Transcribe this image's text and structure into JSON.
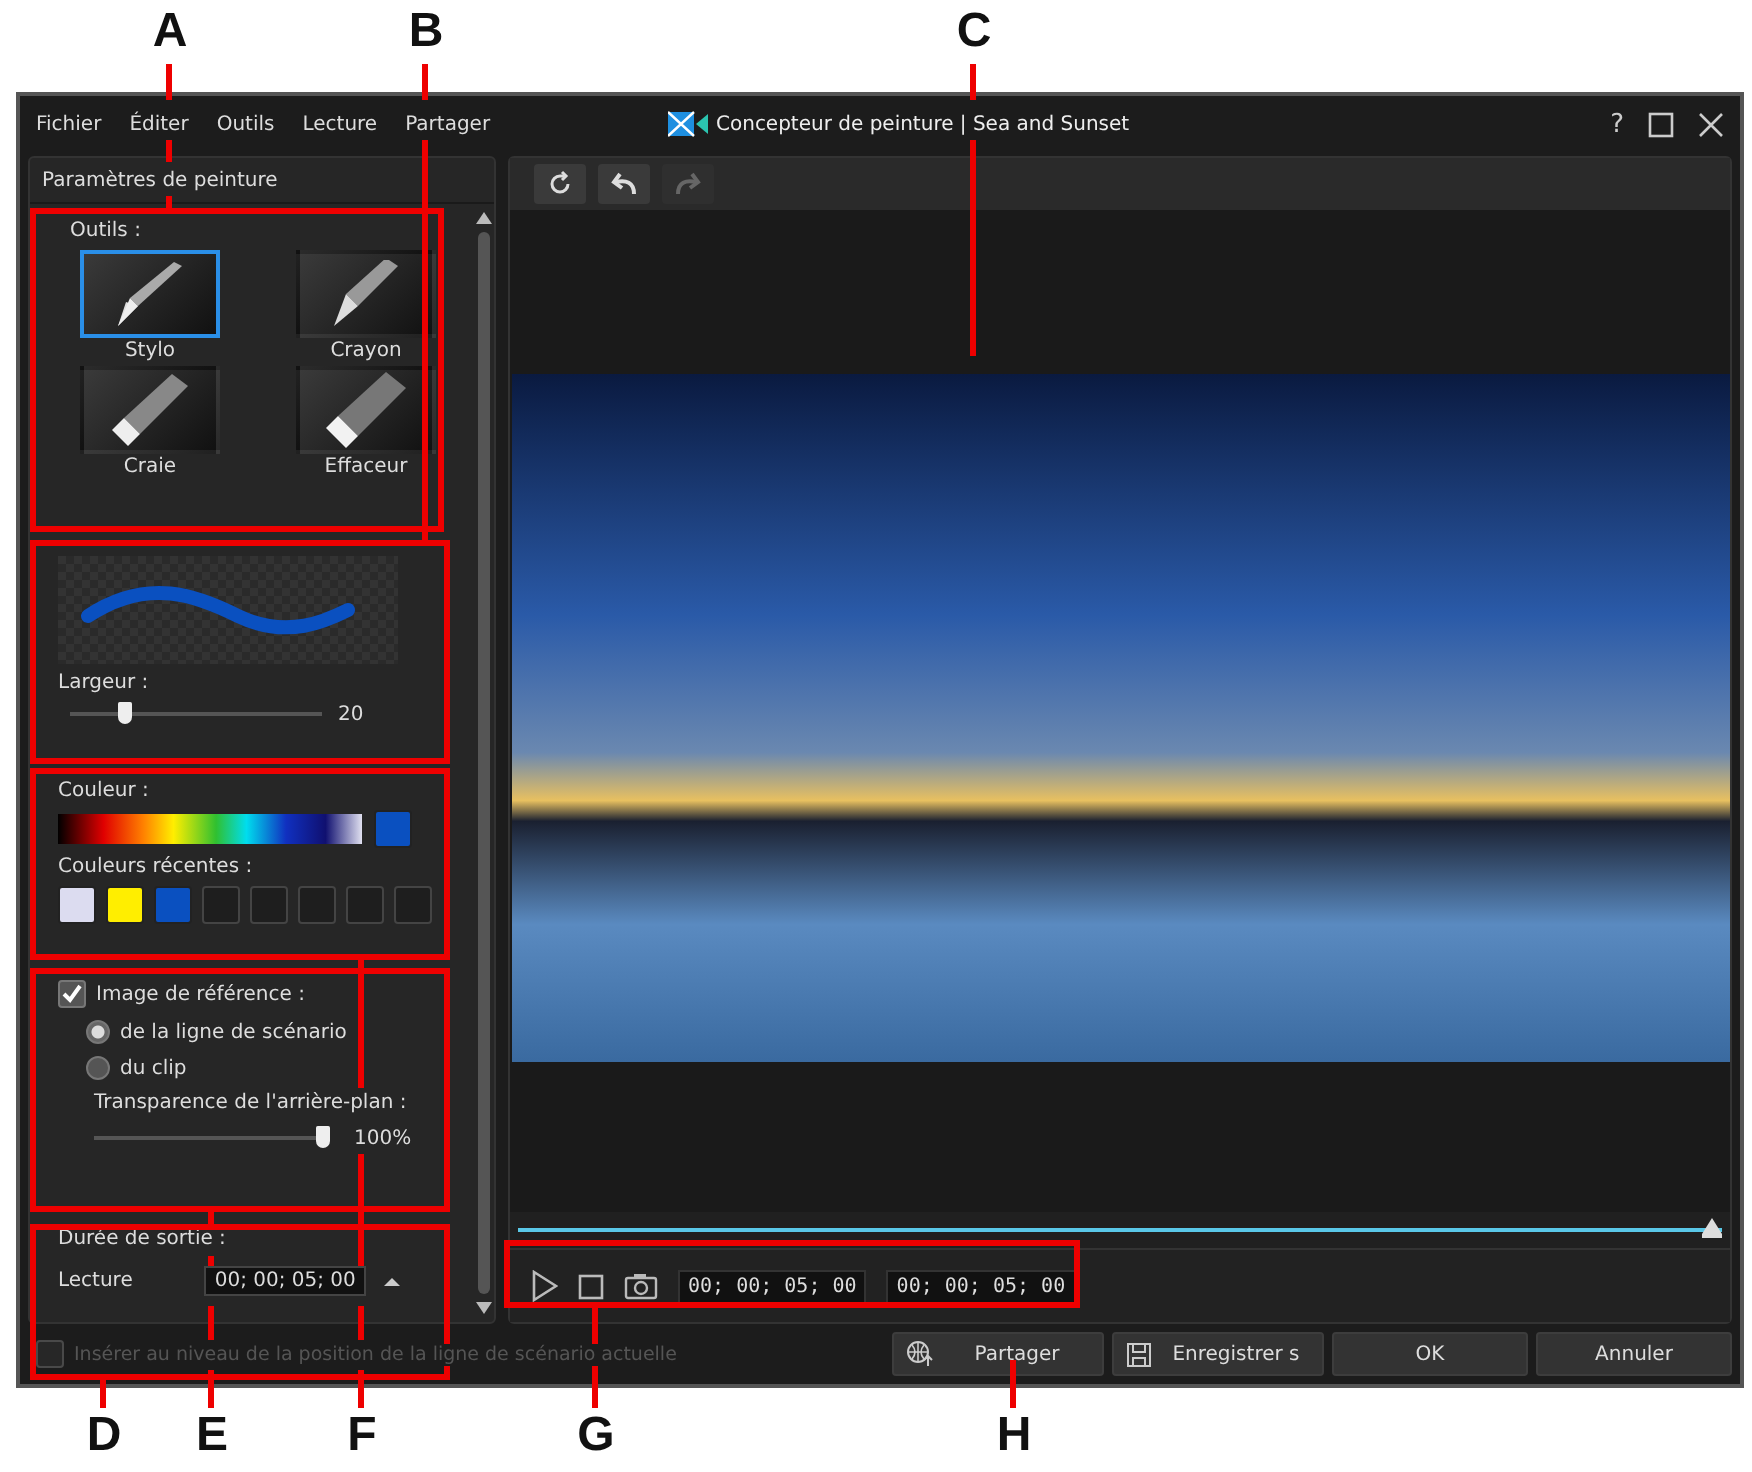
{
  "window": {
    "title": "Concepteur de peinture | Sea and Sunset",
    "help": "?"
  },
  "menu": [
    "Fichier",
    "Éditer",
    "Outils",
    "Lecture",
    "Partager"
  ],
  "panel": {
    "title": "Paramètres de peinture",
    "tools_label": "Outils :",
    "tools": [
      {
        "label": "Stylo",
        "kind": "pen",
        "selected": true
      },
      {
        "label": "Crayon",
        "kind": "pencil",
        "selected": false
      },
      {
        "label": "Craie",
        "kind": "chalk",
        "selected": false
      },
      {
        "label": "Effaceur",
        "kind": "eraser",
        "selected": false
      }
    ],
    "width": {
      "label": "Largeur :",
      "level": 0.2,
      "reading": "20"
    },
    "color": {
      "label": "Couleur :",
      "current": {
        "color": "#0a50c0"
      },
      "recent_label": "Couleurs récentes :",
      "recent": [
        {
          "kind": "swatch",
          "color": "#dcdcf0"
        },
        {
          "kind": "swatch",
          "color": "#ffee00"
        },
        {
          "kind": "swatch",
          "color": "#0a50c0"
        },
        {
          "kind": "empty"
        },
        {
          "kind": "empty"
        },
        {
          "kind": "empty"
        },
        {
          "kind": "empty"
        },
        {
          "kind": "empty"
        }
      ]
    },
    "reference": {
      "label": "Image de référence :",
      "checked": true,
      "options": [
        {
          "label": "de la ligne de scénario",
          "selected": true
        },
        {
          "label": "du clip",
          "selected": false
        }
      ],
      "transparency": {
        "label": "Transparence de l'arrière-plan :",
        "level": 1,
        "reading": "100%"
      }
    },
    "duration": {
      "label": "Durée de sortie :",
      "field_label": "Lecture",
      "value": "00; 00; 05; 00"
    }
  },
  "toolbar": [
    {
      "kind": "reset",
      "disabled": false
    },
    {
      "kind": "undo",
      "disabled": false
    },
    {
      "kind": "redo",
      "disabled": true
    }
  ],
  "preview": {
    "timeline": {
      "level": 1
    },
    "timecodes": [
      "00; 00; 05; 00",
      "00; 00; 05; 00"
    ]
  },
  "insert_option": {
    "label": "Insérer au niveau de la position de la ligne de scénario actuelle",
    "checked": false,
    "disabled": true
  },
  "buttons": [
    {
      "label": "Partager",
      "kind": "share"
    },
    {
      "label": "Enregistrer s",
      "kind": "save"
    },
    {
      "label": "OK",
      "kind": "plain"
    },
    {
      "label": "Annuler",
      "kind": "plain"
    }
  ],
  "callouts": [
    "A",
    "B",
    "C",
    "D",
    "E",
    "F",
    "G",
    "H"
  ]
}
